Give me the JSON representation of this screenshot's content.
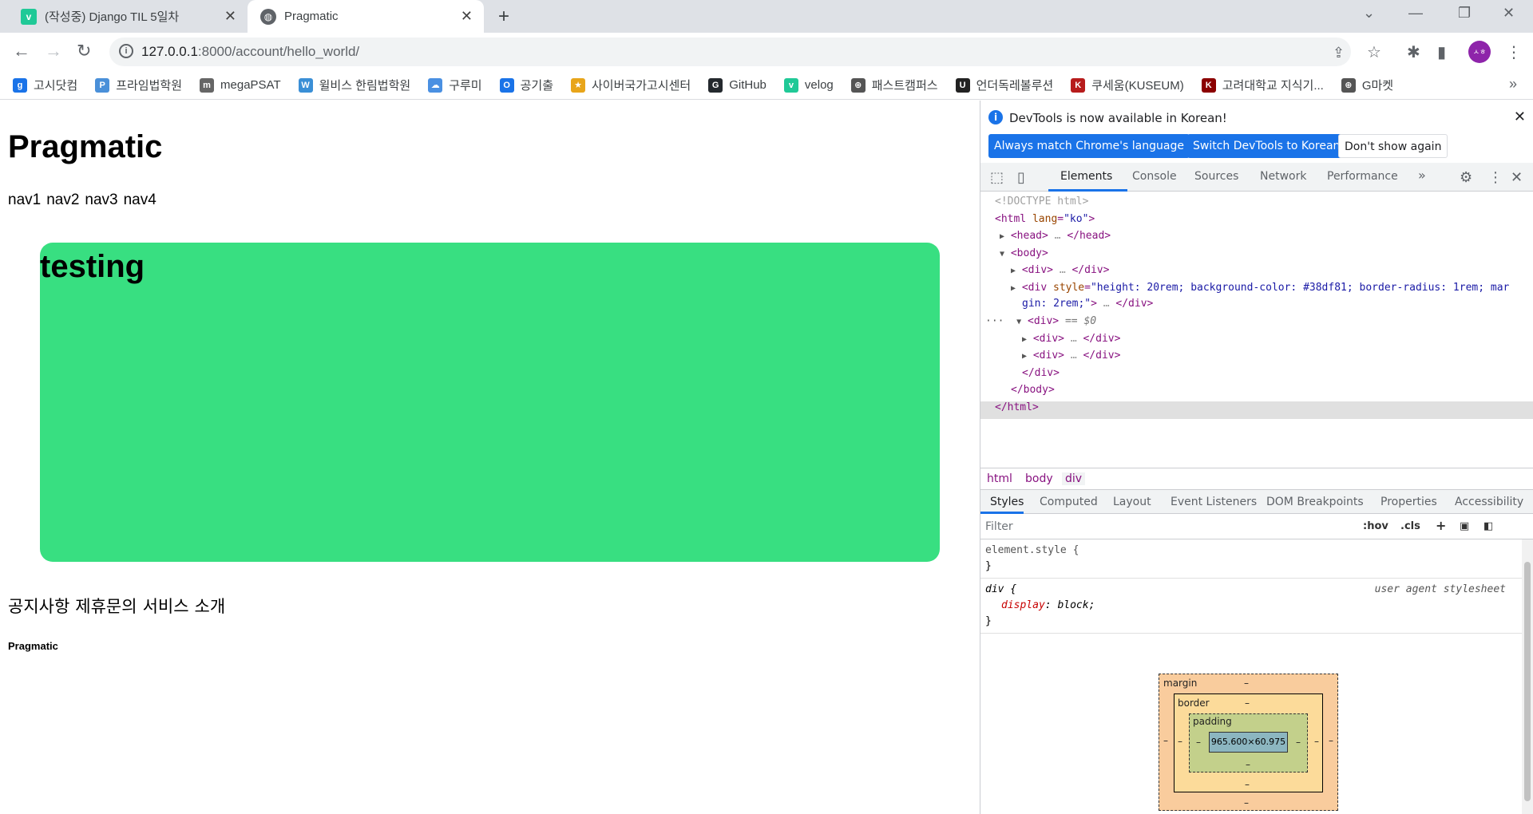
{
  "browser": {
    "tabs": [
      {
        "title": "(작성중) Django TIL 5일차",
        "icon": "velog-icon",
        "active": false
      },
      {
        "title": "Pragmatic",
        "icon": "globe-icon",
        "active": true
      }
    ],
    "new_tab": "+",
    "url_host": "127.0.0.1",
    "url_rest": ":8000/account/hello_world/",
    "profile_initial": "ㅅㅎ"
  },
  "bookmarks": [
    {
      "label": "고시닷컴",
      "color": "#1a73e8",
      "glyph": "g"
    },
    {
      "label": "프라임법학원",
      "color": "#4a90d9",
      "glyph": "P"
    },
    {
      "label": "megaPSAT",
      "color": "#666666",
      "glyph": "m"
    },
    {
      "label": "윌비스 한림법학원",
      "color": "#3a8fd6",
      "glyph": "W"
    },
    {
      "label": "구루미",
      "color": "#4a90e2",
      "glyph": "☁"
    },
    {
      "label": "공기출",
      "color": "#1a73e8",
      "glyph": "O"
    },
    {
      "label": "사이버국가고시센터",
      "color": "#e8a51a",
      "glyph": "★"
    },
    {
      "label": "GitHub",
      "color": "#24292e",
      "glyph": "G"
    },
    {
      "label": "velog",
      "color": "#20c997",
      "glyph": "v"
    },
    {
      "label": "패스트캠퍼스",
      "color": "#555555",
      "glyph": "⊕"
    },
    {
      "label": "언더독레볼루션",
      "color": "#222222",
      "glyph": "U"
    },
    {
      "label": "쿠세움(KUSEUM)",
      "color": "#b71c1c",
      "glyph": "K"
    },
    {
      "label": "고려대학교 지식기...",
      "color": "#8b0000",
      "glyph": "K"
    },
    {
      "label": "G마켓",
      "color": "#555555",
      "glyph": "⊕"
    }
  ],
  "page": {
    "title": "Pragmatic",
    "navs": [
      "nav1",
      "nav2",
      "nav3",
      "nav4"
    ],
    "box_heading": "testing",
    "box_color": "#38df81",
    "footer_links": [
      "공지사항",
      "제휴문의",
      "서비스",
      "소개"
    ],
    "footer_brand": "Pragmatic"
  },
  "devtools": {
    "banner_text": "DevTools is now available in Korean!",
    "btn_match": "Always match Chrome's language",
    "btn_switch": "Switch DevTools to Korean",
    "btn_dont": "Don't show again",
    "tabs": [
      "Elements",
      "Console",
      "Sources",
      "Network",
      "Performance"
    ],
    "more": "»",
    "dom": {
      "doctype": "<!DOCTYPE html>",
      "html_open_tag": "<html",
      "html_attr": "lang",
      "html_val": "\"ko\"",
      "head": "<head>",
      "head_close": "</head>",
      "body": "<body>",
      "div": "<div>",
      "div_close": "</div>",
      "div_style_attr": "style",
      "div_style_val1": "\"height: 20rem; background-color: #38df81; border-radius: 1rem; mar",
      "div_style_val2": "gin: 2rem;\"",
      "selected_div": "<div>",
      "selected_marker": "== $0",
      "body_close": "</body>",
      "html_close": "</html>",
      "ellipsis": "…"
    },
    "breadcrumbs": [
      "html",
      "body",
      "div"
    ],
    "styles_tabs": [
      "Styles",
      "Computed",
      "Layout",
      "Event Listeners",
      "DOM Breakpoints",
      "Properties",
      "Accessibility"
    ],
    "filter_placeholder": "Filter",
    "hov": ":hov",
    "cls": ".cls",
    "rule1_selector": "element.style {",
    "rule1_close": "}",
    "rule2_selector": "div {",
    "rule2_source": "user agent stylesheet",
    "rule2_prop": "display",
    "rule2_val": "block;",
    "rule2_close": "}",
    "box": {
      "margin": "margin",
      "border": "border",
      "padding": "padding",
      "content": "965.600×60.975",
      "dash": "–"
    }
  }
}
